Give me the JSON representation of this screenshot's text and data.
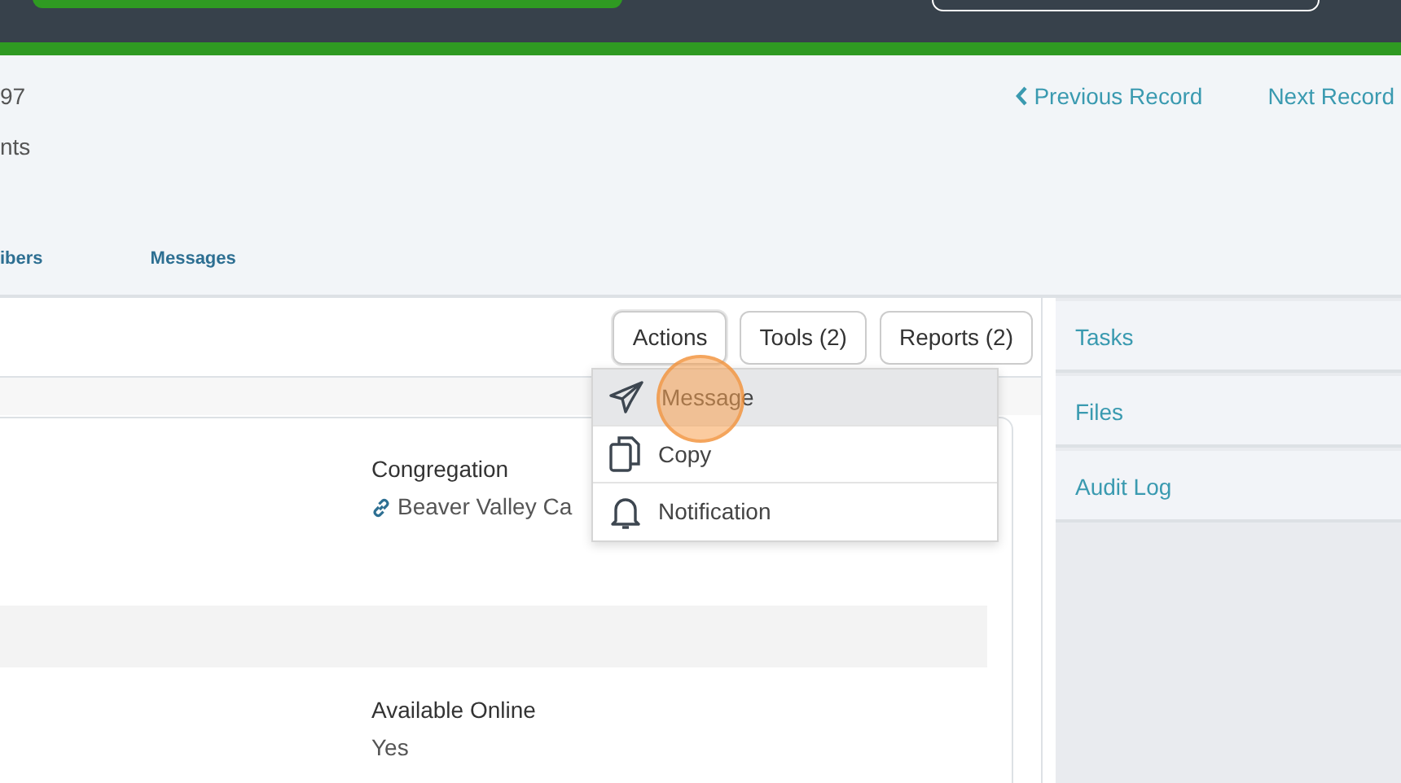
{
  "header": {
    "record_id": "97",
    "subtitle": "nts",
    "prev_link": "Previous Record",
    "next_link": "Next Record"
  },
  "tabs": [
    {
      "label": "ibers",
      "selected": false
    },
    {
      "label": "Messages",
      "selected": false
    }
  ],
  "toolbar": {
    "buttons": [
      {
        "label": "Actions",
        "expanded": true
      },
      {
        "label": "Tools (2)",
        "expanded": false
      },
      {
        "label": "Reports (2)",
        "expanded": false
      }
    ]
  },
  "actions_menu": [
    {
      "kind": "message",
      "label": "Message",
      "selected": true
    },
    {
      "kind": "copy",
      "label": "Copy",
      "selected": false
    },
    {
      "kind": "notification",
      "label": "Notification",
      "selected": false
    }
  ],
  "fields": [
    {
      "label": "Congregation",
      "value": "Beaver Valley Ca",
      "kind": "link"
    },
    {
      "label": "Available Online",
      "value": "Yes",
      "kind": "text"
    }
  ],
  "sidebar": {
    "items": [
      {
        "label": "Tasks"
      },
      {
        "label": "Files"
      },
      {
        "label": "Audit Log"
      }
    ]
  }
}
